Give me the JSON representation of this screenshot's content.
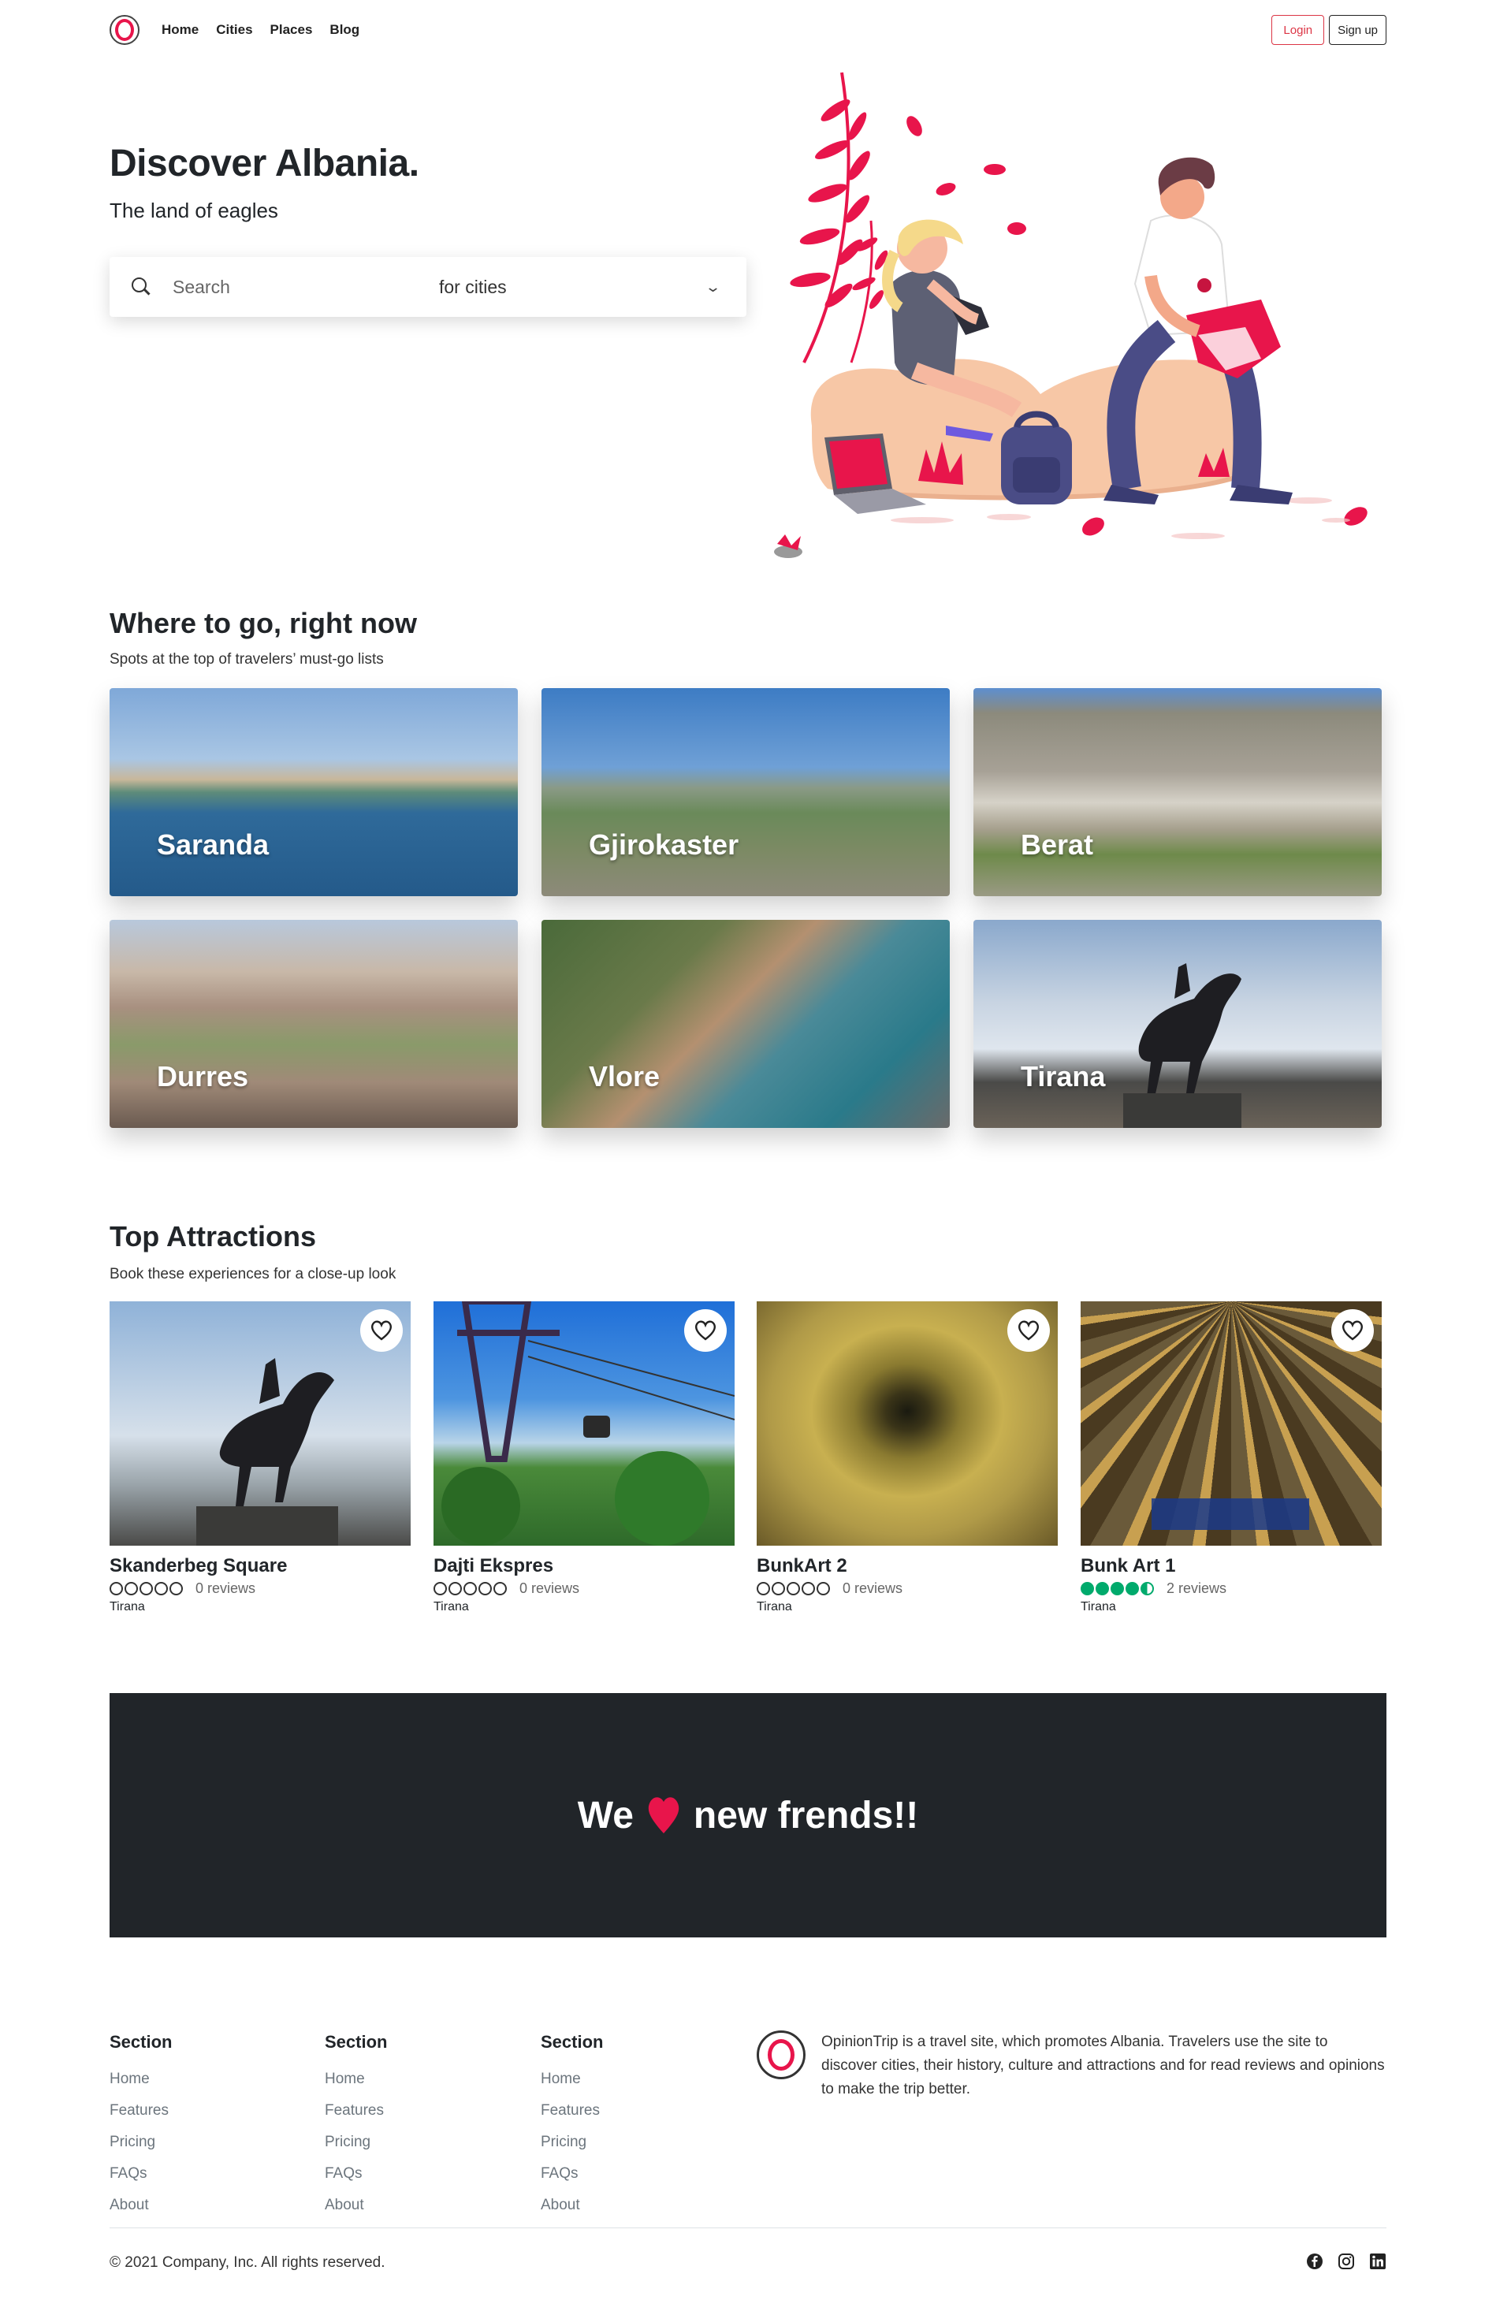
{
  "nav": {
    "links": [
      "Home",
      "Cities",
      "Places",
      "Blog"
    ],
    "login_label": "Login",
    "signup_label": "Sign up"
  },
  "hero": {
    "title": "Discover Albania.",
    "subtitle": "The land of eagles",
    "search_placeholder": "Search",
    "search_scope": "for cities"
  },
  "where_to_go": {
    "title": "Where to go, right now",
    "subtitle": "Spots at the top of travelers’ must-go lists",
    "cities": [
      "Saranda",
      "Gjirokaster",
      "Berat",
      "Durres",
      "Vlore",
      "Tirana"
    ]
  },
  "attractions": {
    "title": "Top Attractions",
    "subtitle": "Book these experiences for a close-up look",
    "items": [
      {
        "name": "Skanderbeg Square",
        "rating": 0,
        "reviews": "0 reviews",
        "city": "Tirana"
      },
      {
        "name": "Dajti Ekspres",
        "rating": 0,
        "reviews": "0 reviews",
        "city": "Tirana"
      },
      {
        "name": "BunkArt 2",
        "rating": 0,
        "reviews": "0 reviews",
        "city": "Tirana"
      },
      {
        "name": "Bunk Art 1",
        "rating": 4.5,
        "reviews": "2 reviews",
        "city": "Tirana"
      }
    ]
  },
  "banner": {
    "text_before": "We",
    "text_after": "new frends!!"
  },
  "footer": {
    "columns": [
      {
        "heading": "Section",
        "links": [
          "Home",
          "Features",
          "Pricing",
          "FAQs",
          "About"
        ]
      },
      {
        "heading": "Section",
        "links": [
          "Home",
          "Features",
          "Pricing",
          "FAQs",
          "About"
        ]
      },
      {
        "heading": "Section",
        "links": [
          "Home",
          "Features",
          "Pricing",
          "FAQs",
          "About"
        ]
      }
    ],
    "about": "OpinionTrip is a travel site, which promotes Albania. Travelers use the site to discover cities, their history, culture and attractions and for read reviews and opinions to make the trip better.",
    "copyright": "© 2021 Company, Inc. All rights reserved.",
    "social_icons": [
      "facebook-icon",
      "instagram-icon",
      "linkedin-icon"
    ]
  },
  "colors": {
    "brand": "#e8154b",
    "login": "#dc3545",
    "rating_green": "#00aa6c",
    "banner_bg": "#212529"
  }
}
